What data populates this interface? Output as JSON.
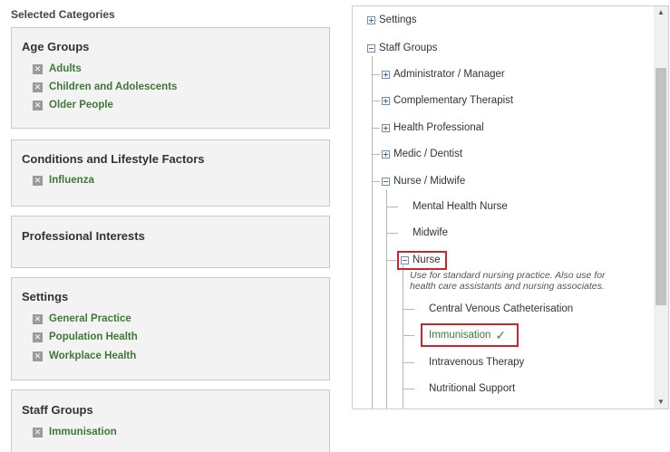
{
  "selected": {
    "title": "Selected Categories",
    "remove_glyph": "✕",
    "groups": [
      {
        "heading": "Age Groups",
        "items": [
          "Adults",
          "Children and Adolescents",
          "Older People"
        ]
      },
      {
        "heading": "Conditions and Lifestyle Factors",
        "items": [
          "Influenza"
        ]
      },
      {
        "heading": "Professional Interests",
        "items": []
      },
      {
        "heading": "Settings",
        "items": [
          "General Practice",
          "Population Health",
          "Workplace Health"
        ]
      },
      {
        "heading": "Staff Groups",
        "items": [
          "Immunisation"
        ]
      }
    ]
  },
  "tree": {
    "settings": "Settings",
    "staff_groups": "Staff Groups",
    "admin": "Administrator / Manager",
    "complementary": "Complementary Therapist",
    "health_prof": "Health Professional",
    "medic": "Medic / Dentist",
    "nurse_midwife": "Nurse / Midwife",
    "mental_health": "Mental Health Nurse",
    "midwife": "Midwife",
    "nurse": "Nurse",
    "nurse_note": "Use for standard nursing practice. Also use for health care assistants and nursing associates.",
    "cvc": "Central Venous Catheterisation",
    "immunisation": "Immunisation",
    "check": "✓",
    "iv": "Intravenous Therapy",
    "nutrition": "Nutritional Support"
  },
  "scrollbar": {
    "up": "▲",
    "down": "▼"
  },
  "colors": {
    "selected_item": "#3d7a35",
    "highlight": "#d0232a",
    "check": "#2f8a2f"
  }
}
